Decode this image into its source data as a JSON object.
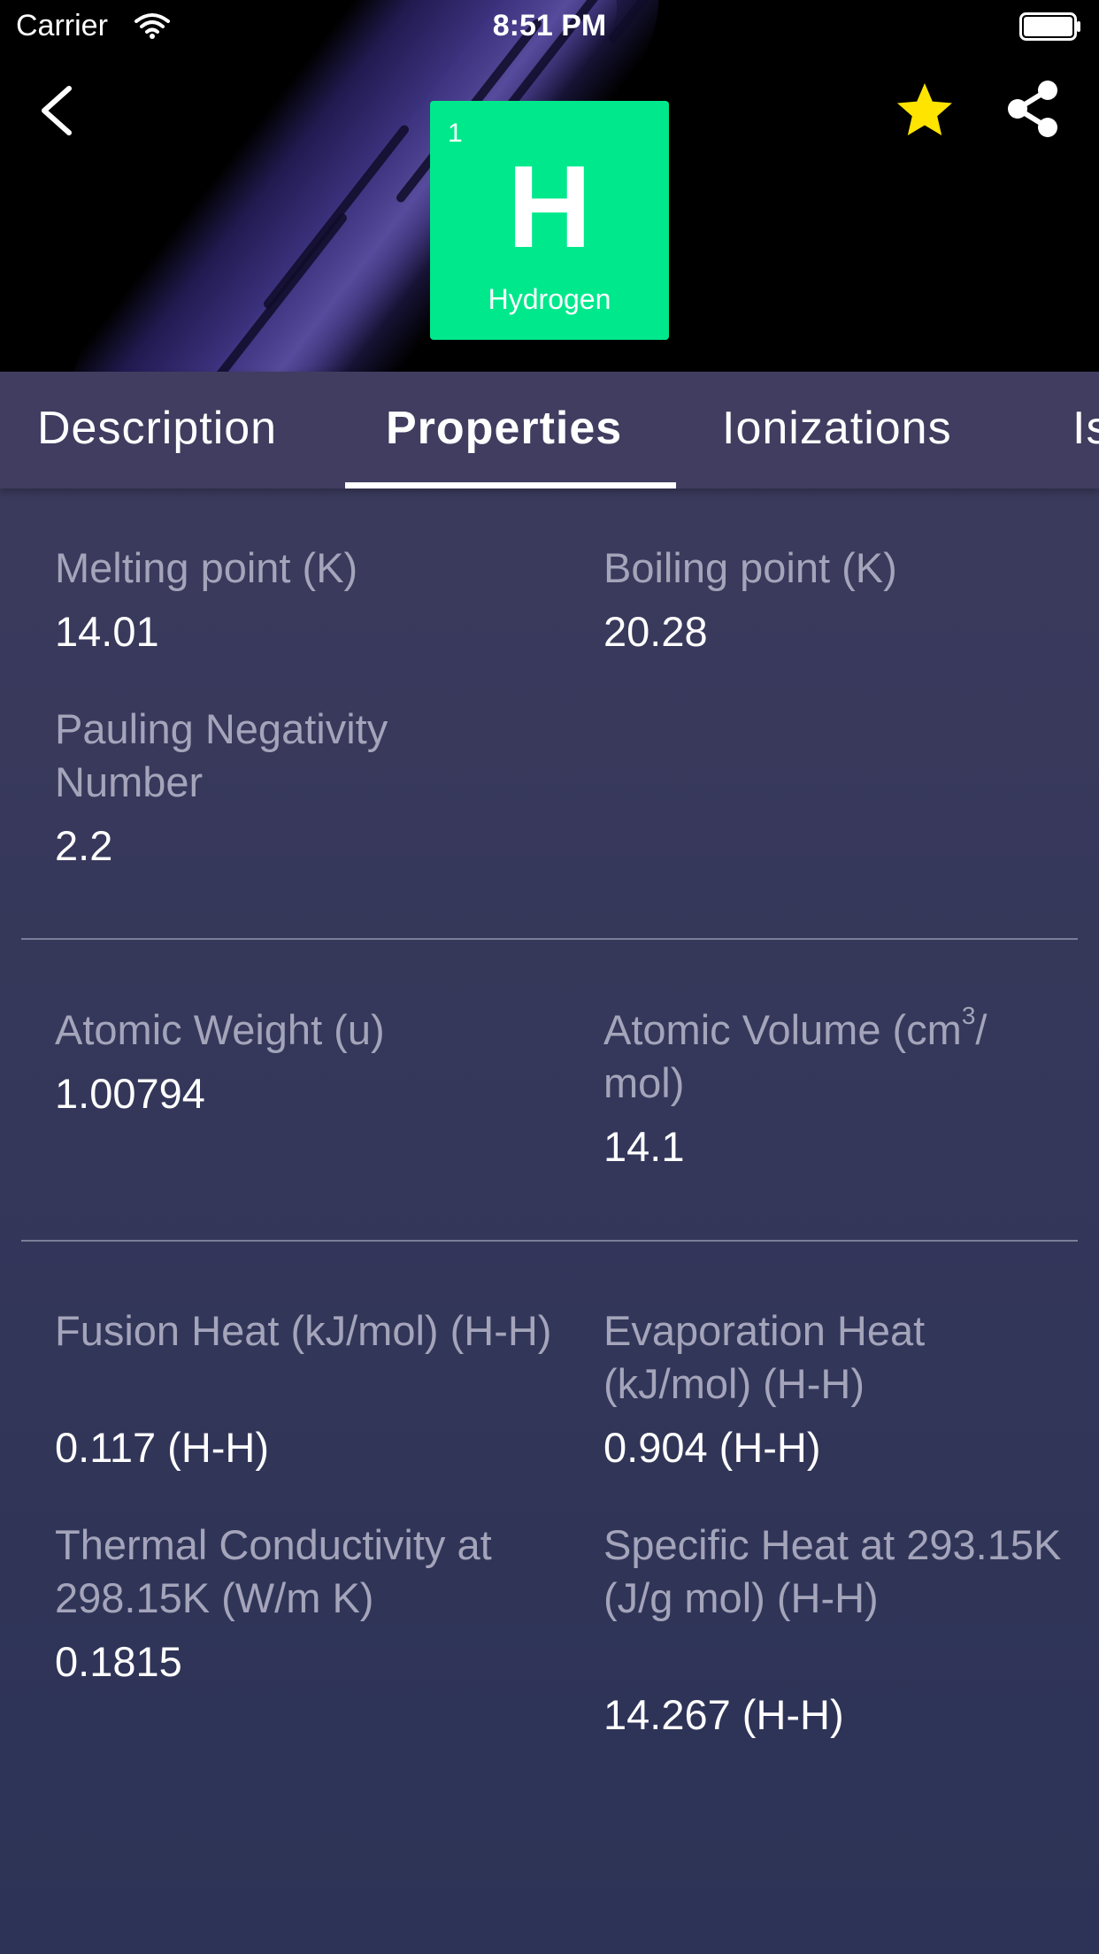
{
  "status_bar": {
    "carrier": "Carrier",
    "time": "8:51 PM"
  },
  "element": {
    "number": "1",
    "symbol": "H",
    "name": "Hydrogen",
    "tile_color": "#00e88c"
  },
  "header_actions": {
    "back_icon": "chevron-left-icon",
    "favorite_icon": "star-icon",
    "favorite_color": "#ffe400",
    "share_icon": "share-icon"
  },
  "tabs": [
    {
      "label": "Description",
      "active": false
    },
    {
      "label": "Properties",
      "active": true
    },
    {
      "label": "Ionizations",
      "active": false
    },
    {
      "label": "Is",
      "active": false
    }
  ],
  "properties": {
    "melting_point": {
      "label": "Melting point (K)",
      "value": "14.01"
    },
    "boiling_point": {
      "label": "Boiling point (K)",
      "value": "20.28"
    },
    "pauling": {
      "label": "Pauling Negativity Number",
      "value": "2.2"
    },
    "atomic_weight": {
      "label": "Atomic Weight (u)",
      "value": "1.00794"
    },
    "atomic_volume": {
      "label_prefix": "Atomic Volume (cm",
      "label_sup": "3",
      "label_suffix": "/ mol)",
      "value": "14.1"
    },
    "fusion_heat": {
      "label": "Fusion Heat (kJ/mol) (H-H)",
      "value": "0.117 (H-H)"
    },
    "evaporation_heat": {
      "label": "Evaporation Heat (kJ/mol) (H-H)",
      "value": "0.904 (H-H)"
    },
    "thermal_conductivity": {
      "label": "Thermal Conductivity at 298.15K (W/m K)",
      "value": "0.1815"
    },
    "specific_heat": {
      "label": "Specific Heat at 293.15K (J/g mol) (H-H)",
      "value": "14.267 (H-H)"
    }
  }
}
